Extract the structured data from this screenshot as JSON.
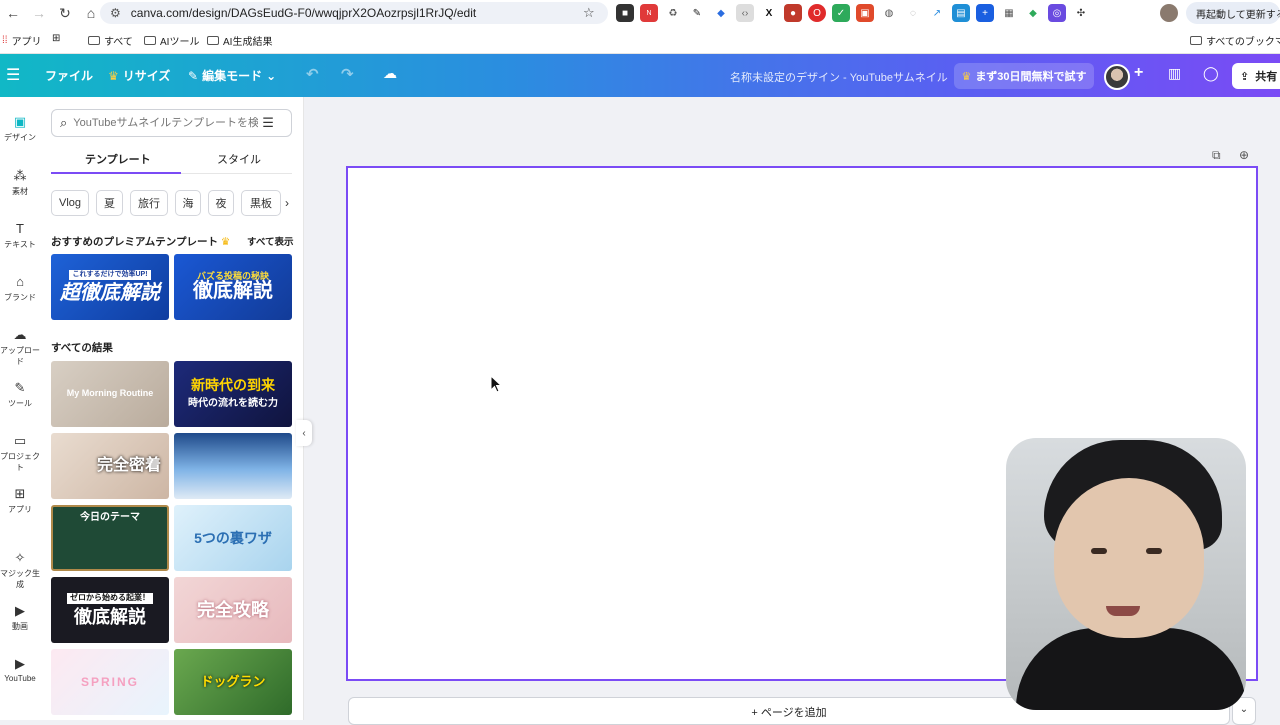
{
  "browser": {
    "url": "canva.com/design/DAGsEudG-F0/wwqjprX2OAozrpsjl1RrJQ/edit",
    "restart_label": "再起動して更新する"
  },
  "bookmarks": {
    "apps": "アプリ",
    "all": "すべて",
    "ai_tools": "AIツール",
    "ai_results": "AI生成結果",
    "all_bookmarks": "すべてのブックマーク"
  },
  "toolbar": {
    "file": "ファイル",
    "resize": "リサイズ",
    "edit_mode": "編集モード",
    "doc_title": "名称未設定のデザイン - YouTubeサムネイル",
    "trial": "まず30日間無料で試す",
    "share": "共有"
  },
  "rail": [
    {
      "label": "デザイン",
      "icon": "design-icon"
    },
    {
      "label": "素材",
      "icon": "elements-icon"
    },
    {
      "label": "テキスト",
      "icon": "text-icon"
    },
    {
      "label": "ブランド",
      "icon": "brand-icon"
    },
    {
      "label": "アップロード",
      "icon": "upload-icon"
    },
    {
      "label": "ツール",
      "icon": "tools-icon"
    },
    {
      "label": "プロジェクト",
      "icon": "projects-icon"
    },
    {
      "label": "アプリ",
      "icon": "apps-icon"
    },
    {
      "label": "マジック生成",
      "icon": "magic-icon"
    },
    {
      "label": "動画",
      "icon": "video-icon"
    },
    {
      "label": "YouTube",
      "icon": "youtube-icon"
    }
  ],
  "panel": {
    "search_placeholder": "YouTubeサムネイルテンプレートを検索",
    "tab_templates": "テンプレート",
    "tab_styles": "スタイル",
    "chips": [
      "Vlog",
      "夏",
      "旅行",
      "海",
      "夜",
      "黒板"
    ],
    "premium_title": "おすすめのプレミアムテンプレート",
    "show_all": "すべて表示",
    "all_results": "すべての結果",
    "premium_thumbs": [
      {
        "text": "超徹底解説",
        "sub": "これするだけで効率UP!"
      },
      {
        "text": "徹底解説",
        "sub": "バズる投稿の秘訣"
      }
    ],
    "result_thumbs": [
      {
        "text": "My Morning Routine"
      },
      {
        "text": "新時代の到来",
        "sub": "時代の流れを読む力"
      },
      {
        "text": "完全密着"
      },
      {
        "text": ""
      },
      {
        "text": "今日のテーマ"
      },
      {
        "text": "5つの裏ワザ"
      },
      {
        "text": "徹底解説",
        "sub": "ゼロから始める起業！"
      },
      {
        "text": "完全攻略"
      },
      {
        "text": "SPRING"
      },
      {
        "text": "ドッグラン"
      }
    ]
  },
  "canvas": {
    "add_page": "+ ページを追加"
  }
}
